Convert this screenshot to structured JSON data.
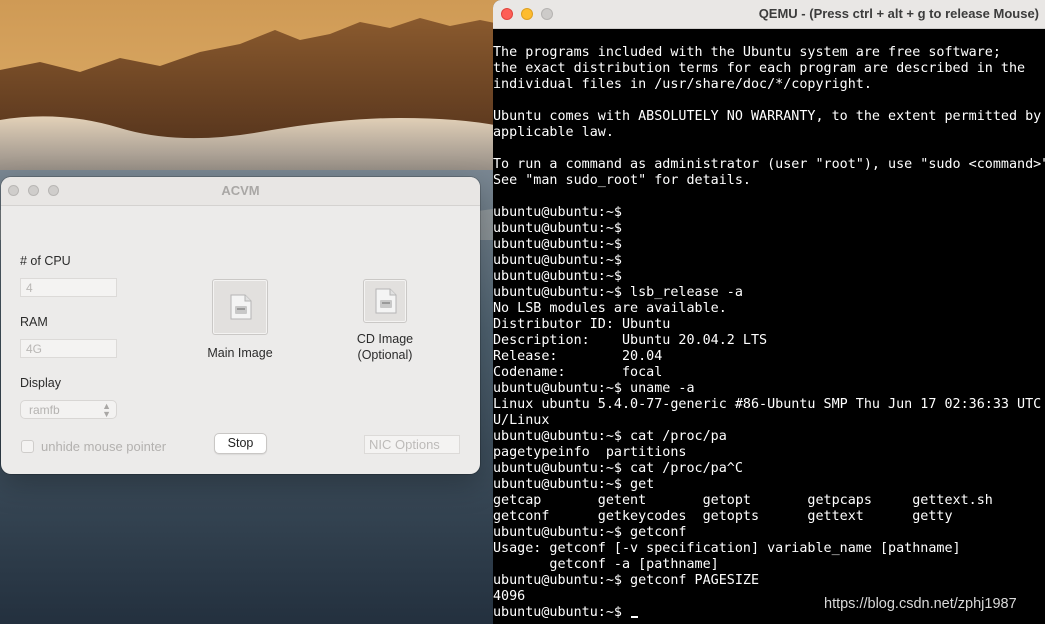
{
  "acvm": {
    "title": "ACVM",
    "cpu_label": "# of CPU",
    "cpu_value": "4",
    "ram_label": "RAM",
    "ram_value": "4G",
    "display_label": "Display",
    "display_value": "ramfb",
    "main_image_label": "Main Image",
    "cd_image_label_line1": "CD Image",
    "cd_image_label_line2": "(Optional)",
    "unhide_mouse_label": "unhide mouse pointer",
    "unhide_mouse_checked": false,
    "stop_label": "Stop",
    "nic_options_placeholder": "NIC Options"
  },
  "qemu": {
    "title": "QEMU - (Press ctrl + alt + g to release Mouse)",
    "terminal_lines": [
      "The programs included with the Ubuntu system are free software;",
      "the exact distribution terms for each program are described in the",
      "individual files in /usr/share/doc/*/copyright.",
      "",
      "Ubuntu comes with ABSOLUTELY NO WARRANTY, to the extent permitted by",
      "applicable law.",
      "",
      "To run a command as administrator (user \"root\"), use \"sudo <command>\".",
      "See \"man sudo_root\" for details.",
      "",
      "ubuntu@ubuntu:~$",
      "ubuntu@ubuntu:~$",
      "ubuntu@ubuntu:~$",
      "ubuntu@ubuntu:~$",
      "ubuntu@ubuntu:~$",
      "ubuntu@ubuntu:~$ lsb_release -a",
      "No LSB modules are available.",
      "Distributor ID: Ubuntu",
      "Description:    Ubuntu 20.04.2 LTS",
      "Release:        20.04",
      "Codename:       focal",
      "ubuntu@ubuntu:~$ uname -a",
      "Linux ubuntu 5.4.0-77-generic #86-Ubuntu SMP Thu Jun 17 02:36:33 UTC",
      "U/Linux",
      "ubuntu@ubuntu:~$ cat /proc/pa",
      "pagetypeinfo  partitions",
      "ubuntu@ubuntu:~$ cat /proc/pa^C",
      "ubuntu@ubuntu:~$ get",
      "getcap       getent       getopt       getpcaps     gettext.sh",
      "getconf      getkeycodes  getopts      gettext      getty",
      "ubuntu@ubuntu:~$ getconf",
      "Usage: getconf [-v specification] variable_name [pathname]",
      "       getconf -a [pathname]",
      "ubuntu@ubuntu:~$ getconf PAGESIZE",
      "4096"
    ],
    "prompt_line": "ubuntu@ubuntu:~$ "
  },
  "watermark": "https://blog.csdn.net/zphj1987",
  "colors": {
    "close": "#fe5f57",
    "minimize": "#febc2e",
    "zoom_inactive": "#cdcbc9",
    "terminal_bg": "#000000",
    "terminal_fg": "#ffffff"
  },
  "icons": [
    "disk-image-icon",
    "chevron-updown-icon"
  ]
}
